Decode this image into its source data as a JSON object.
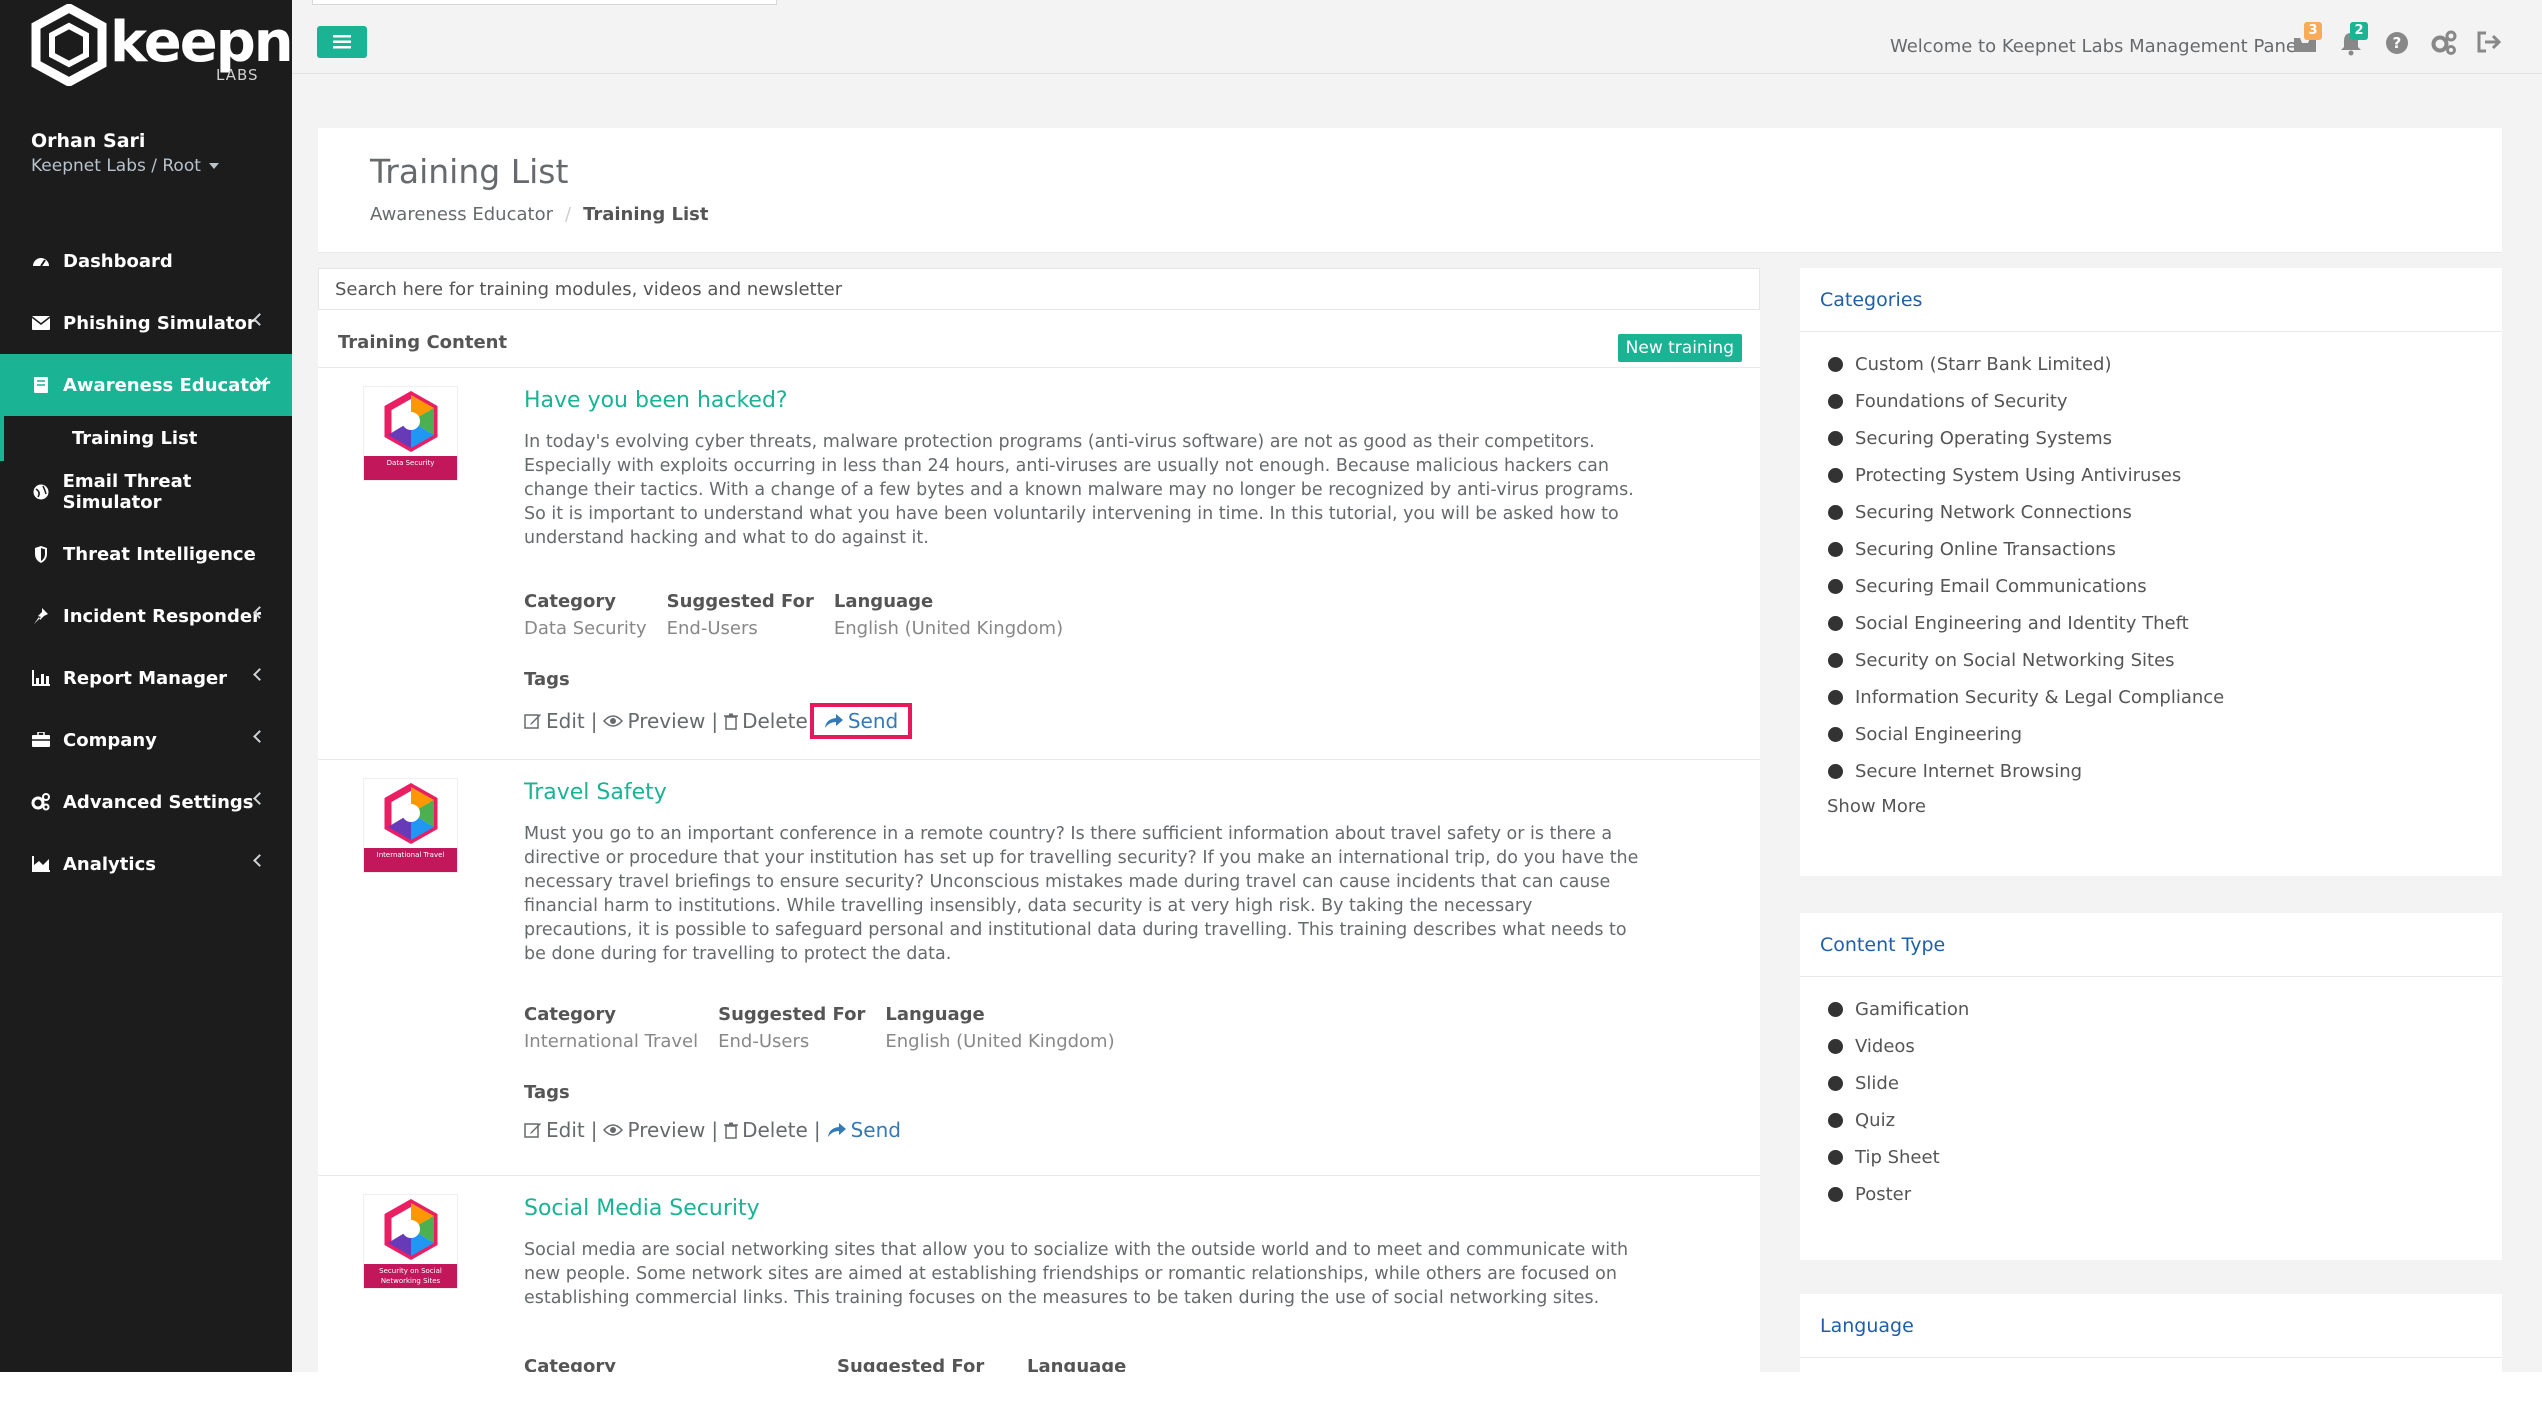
{
  "brand": {
    "name": "keepnet",
    "sub": "LABS"
  },
  "profile": {
    "name": "Orhan Sari",
    "org": "Keepnet Labs / Root"
  },
  "nav": [
    {
      "label": "Dashboard",
      "icon": "dashboard-icon",
      "expandable": false
    },
    {
      "label": "Phishing Simulator",
      "icon": "envelope-icon",
      "expandable": true
    },
    {
      "label": "Awareness Educator",
      "icon": "book-icon",
      "expandable": true,
      "active": true
    },
    {
      "label": "Email Threat Simulator",
      "icon": "globe-icon",
      "expandable": false
    },
    {
      "label": "Threat Intelligence",
      "icon": "shield-icon",
      "expandable": false
    },
    {
      "label": "Incident Responder",
      "icon": "pin-icon",
      "expandable": true
    },
    {
      "label": "Report Manager",
      "icon": "bar-chart-icon",
      "expandable": true
    },
    {
      "label": "Company",
      "icon": "briefcase-icon",
      "expandable": true
    },
    {
      "label": "Advanced Settings",
      "icon": "gears-icon",
      "expandable": true
    },
    {
      "label": "Analytics",
      "icon": "area-chart-icon",
      "expandable": true
    }
  ],
  "nav_sub": {
    "label": "Training List"
  },
  "topbar": {
    "welcome": "Welcome to Keepnet Labs Management Panel",
    "mail_badge": "3",
    "bell_badge": "2",
    "badge_colors": {
      "mail": "#f8ac59",
      "bell": "#1ab394"
    }
  },
  "heading": {
    "title": "Training List",
    "breadcrumb": [
      "Awareness Educator",
      "Training List"
    ]
  },
  "search": {
    "placeholder": "Search here for training modules, videos and newsletter"
  },
  "section": {
    "title": "Training Content",
    "new_button": "New training"
  },
  "labels": {
    "category": "Category",
    "suggested_for": "Suggested For",
    "language": "Language",
    "tags": "Tags",
    "edit": "Edit",
    "preview": "Preview",
    "delete": "Delete",
    "send": "Send"
  },
  "trainings": [
    {
      "title": "Have you been hacked?",
      "thumb_label": "Data Security",
      "description": "In today's evolving cyber threats, malware protection programs (anti-virus software) are not as good as their competitors. Especially with exploits occurring in less than 24 hours, anti-viruses are usually not enough. Because malicious hackers can change their tactics. With a change of a few bytes and a known malware may no longer be recognized by anti-virus programs. So it is important to understand what you have been voluntarily intervening in time. In this tutorial, you will be asked how to understand hacking and what to do against it.",
      "category": "Data Security",
      "suggested_for": "End-Users",
      "language": "English (United Kingdom)"
    },
    {
      "title": "Travel Safety",
      "thumb_label": "International Travel",
      "description": "Must you go to an important conference in a remote country? Is there sufficient information about travel safety or is there a directive or procedure that your institution has set up for travelling security? If you make an international trip, do you have the necessary travel briefings to ensure security? Unconscious mistakes made during travel can cause incidents that can cause financial harm to institutions. While travelling insensibly, data security is at very high risk. By taking the necessary precautions, it is possible to safeguard personal and institutional data during travelling. This training describes what needs to be done during for travelling to protect the data.",
      "category": "International Travel",
      "suggested_for": "End-Users",
      "language": "English (United Kingdom)"
    },
    {
      "title": "Social Media Security",
      "thumb_label": "Security on Social Networking Sites",
      "description": "Social media are social networking sites that allow you to socialize with the outside world and to meet and communicate with new people. Some network sites are aimed at establishing friendships or romantic relationships, while others are focused on establishing commercial links. This training focuses on the measures to be taken during the use of social networking sites."
    }
  ],
  "categories": {
    "title": "Categories",
    "items": [
      "Custom (Starr Bank Limited)",
      "Foundations of Security",
      "Securing Operating Systems",
      "Protecting System Using Antiviruses",
      "Securing Network Connections",
      "Securing Online Transactions",
      "Securing Email Communications",
      "Social Engineering and Identity Theft",
      "Security on Social Networking Sites",
      "Information Security & Legal Compliance",
      "Social Engineering",
      "Secure Internet Browsing"
    ],
    "more": "Show More"
  },
  "content_type": {
    "title": "Content Type",
    "items": [
      "Gamification",
      "Videos",
      "Slide",
      "Quiz",
      "Tip Sheet",
      "Poster"
    ]
  },
  "language_box": {
    "title": "Language"
  },
  "colors": {
    "accent": "#1ab394",
    "sidebar": "#1c1c1c",
    "link": "#1f5ea8",
    "highlight": "#e6195a"
  }
}
